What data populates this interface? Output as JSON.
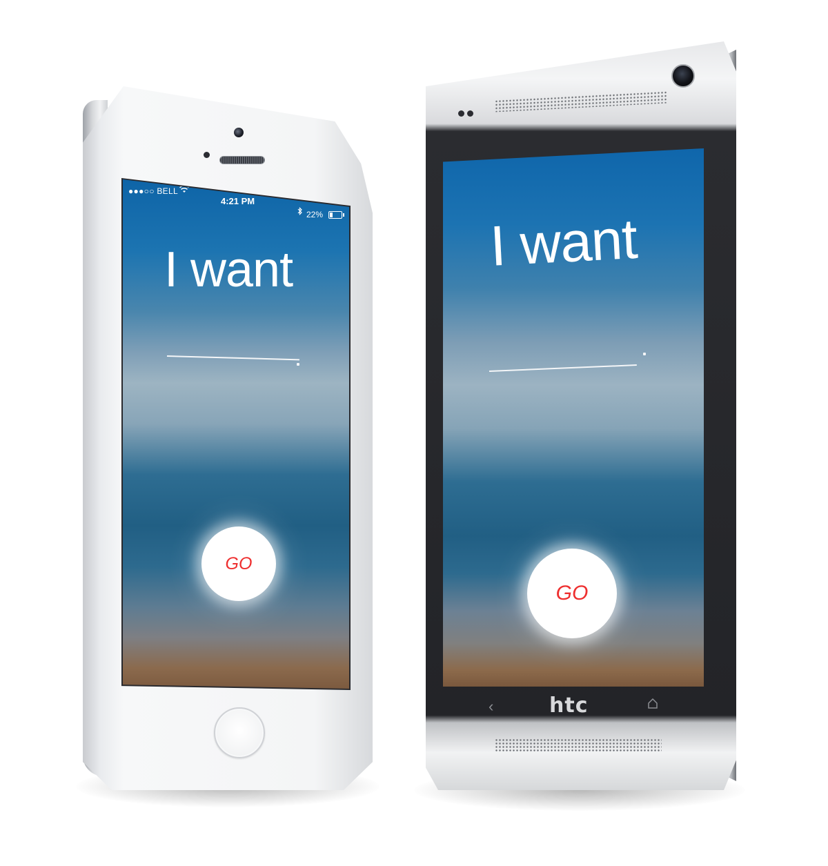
{
  "iphone": {
    "status_bar": {
      "carrier": "●●●○○ BELL",
      "wifi_icon": "wifi-icon",
      "time": "4:21 PM",
      "bluetooth_icon": "bluetooth-icon",
      "battery_percent": "22%",
      "battery_level": 0.22
    },
    "prompt": "I want",
    "go_label": "GO"
  },
  "htc": {
    "prompt": "I want",
    "go_label": "GO",
    "brand": "htc",
    "nav": {
      "back_icon": "back-icon",
      "home_icon": "home-icon"
    }
  },
  "colors": {
    "accent_red": "#ee2f2f",
    "screen_blue": "#1c73b2",
    "text_white": "#ffffff"
  }
}
